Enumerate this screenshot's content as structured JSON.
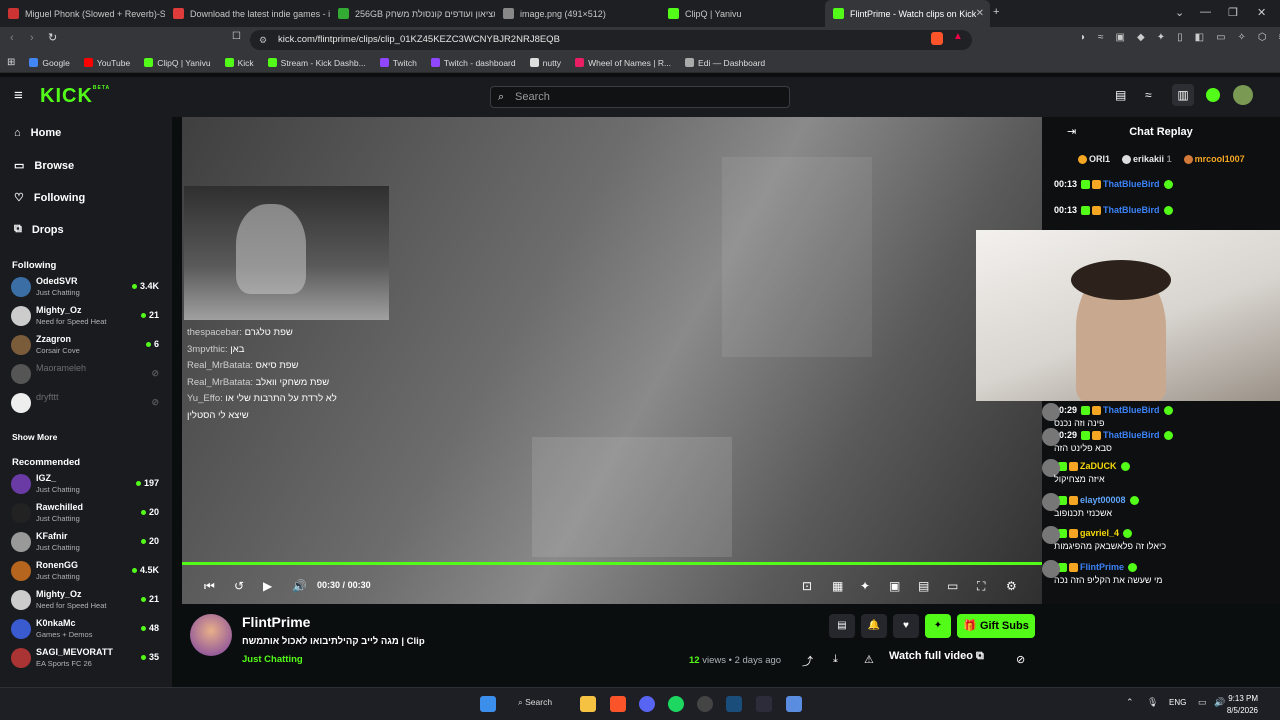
{
  "browser": {
    "tabs": [
      {
        "title": "Miguel Phonk (Slowed + Reverb)-Sin",
        "color": "#c33"
      },
      {
        "title": "Download the latest indie games - it",
        "color": "#e03b3b"
      },
      {
        "title": "256GB מציאון ועודפים קונסולת משחק",
        "color": "#3a3"
      },
      {
        "title": "image.png (491×512)",
        "color": "#888"
      },
      {
        "title": "ClipQ | Yanivu",
        "color": "#53fc18"
      },
      {
        "title": "FlintPrime - Watch clips on Kick",
        "color": "#53fc18",
        "active": true
      }
    ],
    "url": "kick.com/flintprime/clips/clip_01KZ45KEZC3WCNYBJR2NRJ8EQB",
    "bookmarks": [
      {
        "label": "Google",
        "color": "#4285f4"
      },
      {
        "label": "YouTube",
        "color": "#f00"
      },
      {
        "label": "ClipQ | Yanivu",
        "color": "#53fc18"
      },
      {
        "label": "Kick",
        "color": "#53fc18"
      },
      {
        "label": "Stream - Kick Dashb...",
        "color": "#53fc18"
      },
      {
        "label": "Twitch",
        "color": "#9146ff"
      },
      {
        "label": "Twitch - dashboard",
        "color": "#9146ff"
      },
      {
        "label": "nutty",
        "color": "#ddd"
      },
      {
        "label": "Wheel of Names | R...",
        "color": "#e91e63"
      },
      {
        "label": "Edi — Dashboard",
        "color": "#aaa"
      }
    ]
  },
  "header": {
    "logo": "KICK",
    "logo_sup": "BETA",
    "search_placeholder": "Search"
  },
  "sidebar": {
    "nav": [
      {
        "label": "Home",
        "icon": "home-icon"
      },
      {
        "label": "Browse",
        "icon": "browse-icon"
      },
      {
        "label": "Following",
        "icon": "heart-icon"
      },
      {
        "label": "Drops",
        "icon": "drops-icon"
      }
    ],
    "following_title": "Following",
    "following": [
      {
        "name": "OdedSVR",
        "category": "Just Chatting",
        "viewers": "3.4K",
        "color": "#3a6ea5"
      },
      {
        "name": "Mighty_Oz",
        "category": "Need for Speed Heat",
        "viewers": "21",
        "color": "#ccc"
      },
      {
        "name": "Zzagron",
        "category": "Corsair Cove",
        "viewers": "6",
        "color": "#7a5c3a"
      },
      {
        "name": "Maorameleh",
        "category": "",
        "viewers": "",
        "color": "#555",
        "offline": true
      },
      {
        "name": "dryfttt",
        "category": "",
        "viewers": "",
        "color": "#eee",
        "offline": true
      }
    ],
    "show_more": "Show More",
    "recommended_title": "Recommended",
    "recommended": [
      {
        "name": "IGZ_",
        "category": "Just Chatting",
        "viewers": "197",
        "color": "#6a3aa5"
      },
      {
        "name": "Rawchilled",
        "category": "Just Chatting",
        "viewers": "20",
        "color": "#222"
      },
      {
        "name": "KFafnir",
        "category": "Just Chatting",
        "viewers": "20",
        "color": "#999"
      },
      {
        "name": "RonenGG",
        "category": "Just Chatting",
        "viewers": "4.5K",
        "color": "#b5651d"
      },
      {
        "name": "Mighty_Oz",
        "category": "Need for Speed Heat",
        "viewers": "21",
        "color": "#ccc"
      },
      {
        "name": "K0nkaMc",
        "category": "Games + Demos",
        "viewers": "48",
        "color": "#3a5ad0"
      },
      {
        "name": "SAGI_MEVORATT",
        "category": "EA Sports FC 26",
        "viewers": "35",
        "color": "#a33"
      }
    ]
  },
  "video": {
    "overlay_chat": [
      {
        "user": "thespacebar:",
        "text": "שפת טלגרם"
      },
      {
        "user": "3mpvthic:",
        "text": "באן"
      },
      {
        "user": "Real_MrBatata:",
        "text": "שפת סיאס"
      },
      {
        "user": "Real_MrBatata:",
        "text": "שפת משחקי וואלב"
      },
      {
        "user": "Yu_Effo:",
        "text": "לא לרדת על התרבות שלי או"
      },
      {
        "user": "",
        "text": "שיצא לי הסטלין"
      }
    ],
    "time_current": "00:30",
    "time_sep": "/",
    "time_total": "00:30",
    "progress": 1.0
  },
  "chat": {
    "title": "Chat Replay",
    "pinned": [
      {
        "name": "ORI1",
        "rank": "2"
      },
      {
        "name": "erikakii",
        "rank": "1"
      },
      {
        "name": "mrcool1007",
        "rank": ""
      }
    ],
    "messages": [
      {
        "time": "00:13",
        "user": "ThatBlueBird",
        "color": "#3b82f6",
        "text": ""
      },
      {
        "time": "00:13",
        "user": "ThatBlueBird",
        "color": "#3b82f6",
        "text": ""
      },
      {
        "time": "00:29",
        "user": "ThatBlueBird",
        "color": "#3b82f6",
        "text": "פינה וזה נכנס"
      },
      {
        "time": "00:29",
        "user": "ThatBlueBird",
        "color": "#3b82f6",
        "text": "סבא פלינט הזה"
      },
      {
        "time": "",
        "user": "ZaDUCK",
        "color": "#f5d90a",
        "text": "איזה מצחיקול"
      },
      {
        "time": "",
        "user": "elayt00008",
        "color": "#60a5fa",
        "text": "אשכנזי תכנופוב"
      },
      {
        "time": "",
        "user": "gavriel_4",
        "color": "#f5d90a",
        "text": "כיאלו זה פלאשבאק מהפיגמות"
      },
      {
        "time": "",
        "user": "FlintPrime",
        "color": "#3b82f6",
        "text": "מי שעשה את הקליפ הזה נכה"
      }
    ]
  },
  "clip": {
    "streamer": "FlintPrime",
    "title": "מגה לייב קהילתיבואו לאכול אותמשח | Clip",
    "category": "Just Chatting",
    "views": "12",
    "views_label": "views",
    "age": "• 2 days ago",
    "gift_label": "Gift Subs",
    "watch_label": "Watch full video"
  },
  "taskbar": {
    "search_label": "Search",
    "lang": "ENG",
    "time": "9:13 PM",
    "date": "8/5/2026"
  }
}
